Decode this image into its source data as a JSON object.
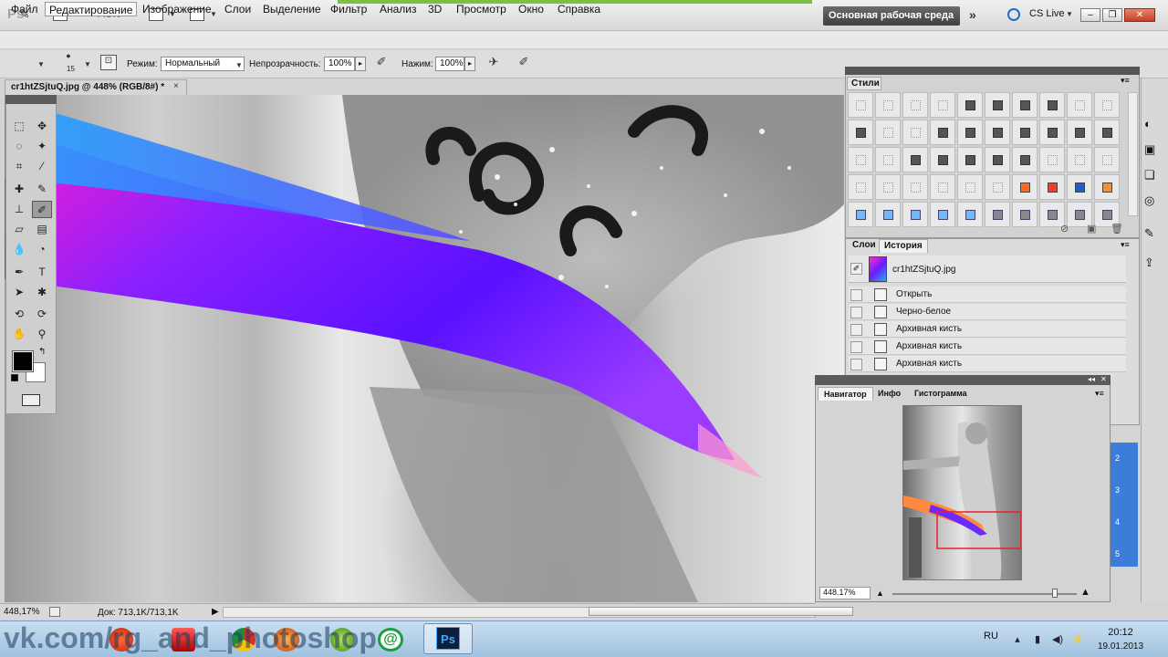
{
  "app": {
    "logo": "Ps",
    "zoom_readout": "448%",
    "workspace": "Основная рабочая среда",
    "cs_live": "CS Live"
  },
  "menu": [
    "Файл",
    "Редактирование",
    "Изображение",
    "Слои",
    "Выделение",
    "Фильтр",
    "Анализ",
    "3D",
    "Просмотр",
    "Окно",
    "Справка"
  ],
  "options": {
    "brush_size": "15",
    "mode_label": "Режим:",
    "mode_value": "Нормальный",
    "opacity_label": "Непрозрачность:",
    "opacity_value": "100%",
    "pressure_label": "Нажим:",
    "pressure_value": "100%"
  },
  "document": {
    "tab_title": "cr1htZSjtuQ.jpg @ 448% (RGB/8#) *",
    "close": "×"
  },
  "styles_panel": {
    "tab": "Стили"
  },
  "history_panel": {
    "tabs": [
      "Слои",
      "История"
    ],
    "snapshot": "cr1htZSjtuQ.jpg",
    "steps": [
      "Открыть",
      "Черно-белое",
      "Архивная кисть",
      "Архивная кисть",
      "Архивная кисть"
    ]
  },
  "navigator_panel": {
    "tabs": [
      "Навигатор",
      "Инфо",
      "Гистограмма"
    ],
    "zoom": "448.17%",
    "zoom_fraction": 0.88
  },
  "status": {
    "zoom": "448,17%",
    "doc": "Док: 713,1K/713,1K"
  },
  "right_strip_numbers": [
    "2",
    "3",
    "4",
    "5"
  ],
  "taskbar": {
    "watermark": "vk.com/rg_and_photoshop",
    "ps_icon": "Ps",
    "lang": "RU",
    "time": "20:12",
    "date": "19.01.2013"
  },
  "colors": {
    "foreground": "#000000",
    "background": "#ffffff",
    "workspace_btn": "#4a4a4a",
    "accent_blue": "#3b7dd8"
  }
}
